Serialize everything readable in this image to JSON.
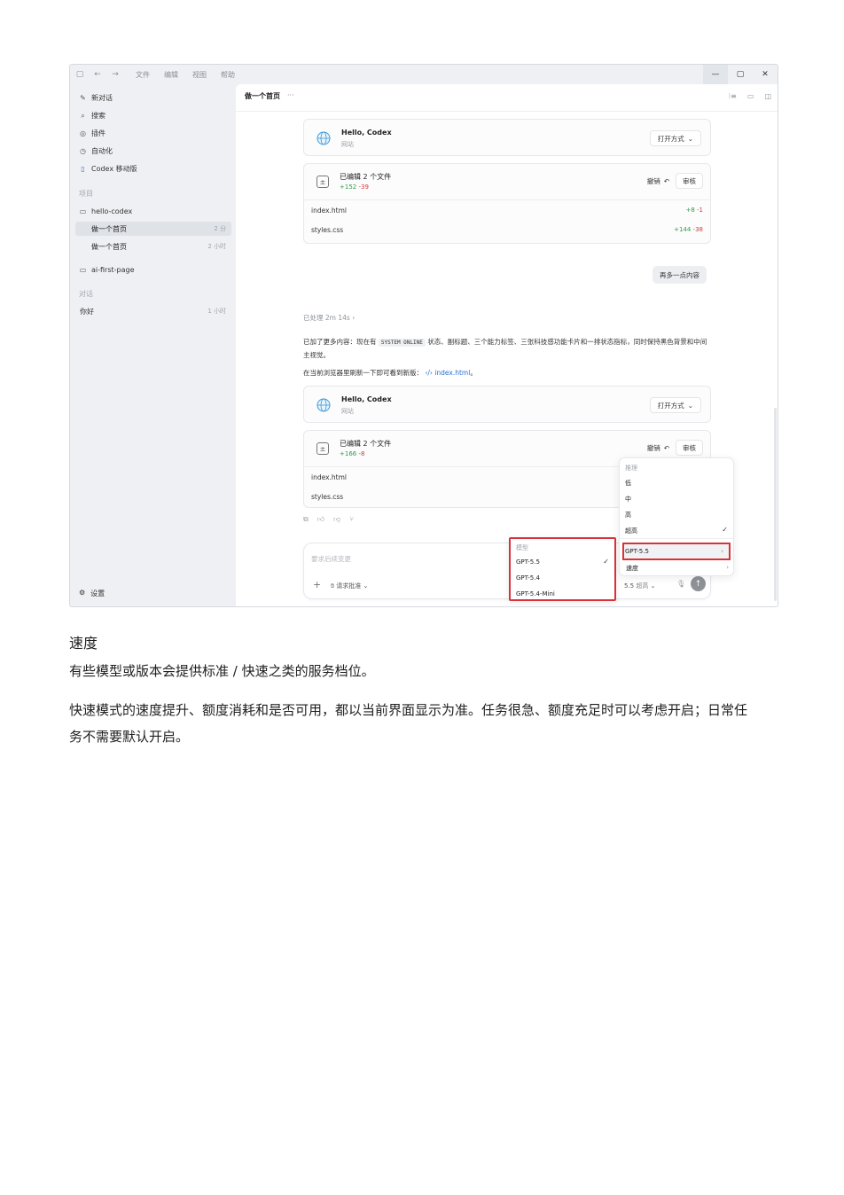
{
  "titlebar": {
    "menu": [
      "文件",
      "编辑",
      "视图",
      "帮助"
    ]
  },
  "sidebar": {
    "nav": [
      {
        "icon": "edit-icon",
        "label": "新对话"
      },
      {
        "icon": "search-icon",
        "label": "搜索"
      },
      {
        "icon": "plugin-icon",
        "label": "插件"
      },
      {
        "icon": "clock-icon",
        "label": "自动化"
      },
      {
        "icon": "mobile-icon",
        "label": "Codex 移动版"
      }
    ],
    "projects_heading": "项目",
    "project_hello": "hello-codex",
    "threads": [
      {
        "title": "做一个首页",
        "time": "2 分"
      },
      {
        "title": "做一个首页",
        "time": "2 小时"
      }
    ],
    "project_ai": "ai-first-page",
    "chats_heading": "对话",
    "chat": {
      "title": "你好",
      "time": "1 小时"
    },
    "settings": "设置"
  },
  "main": {
    "title": "做一个首页",
    "more": "···",
    "site_card_1": {
      "title": "Hello, Codex",
      "subtitle": "网站",
      "open": "打开方式"
    },
    "files_card_1": {
      "title": "已编辑 2 个文件",
      "add": "+152",
      "del": "-39",
      "undo": "撤销",
      "review": "审核",
      "files": [
        {
          "name": "index.html",
          "add": "+8",
          "del": "-1"
        },
        {
          "name": "styles.css",
          "add": "+144",
          "del": "-38"
        }
      ]
    },
    "more_button": "再多一点内容",
    "processed": "已处理 2m 14s",
    "para1_a": "已加了更多内容：现在有 ",
    "para1_code": "SYSTEM ONLINE",
    "para1_b": " 状态、副标题、三个能力标签、三张科技感功能卡片和一排状态指标，同时保持黑色背景和中间主视觉。",
    "para2_a": "在当前浏览器里刷新一下即可看到新版：",
    "para2_link": "index.html",
    "para2_b": "。",
    "site_card_2": {
      "title": "Hello, Codex",
      "subtitle": "网站",
      "open": "打开方式"
    },
    "files_card_2": {
      "title": "已编辑 2 个文件",
      "add": "+166",
      "del": "-8",
      "undo": "撤销",
      "review": "审核",
      "files": [
        {
          "name": "index.html"
        },
        {
          "name": "styles.css"
        }
      ]
    },
    "composer": {
      "placeholder": "要求后续变更",
      "approve": "请求批准",
      "model": "5.5",
      "effort": "超高"
    },
    "model_menu": {
      "heading": "模型",
      "options": [
        "GPT-5.5",
        "GPT-5.4",
        "GPT-5.4-Mini"
      ],
      "selected": "GPT-5.5"
    },
    "reasoning_menu": {
      "heading": "推理",
      "options": [
        "低",
        "中",
        "高",
        "超高"
      ],
      "selected": "超高",
      "model_row": "GPT-5.5",
      "speed_row": "速度"
    }
  },
  "doc": {
    "heading": "速度",
    "p1": "有些模型或版本会提供标准 / 快速之类的服务档位。",
    "p2": "快速模式的速度提升、额度消耗和是否可用，都以当前界面显示为准。任务很急、额度充足时可以考虑开启；日常任务不需要默认开启。"
  },
  "colors": {
    "highlight_red": "#d9323a",
    "diff_add": "#2e9b45",
    "diff_del": "#d23b3b",
    "link": "#2a6fd6"
  }
}
